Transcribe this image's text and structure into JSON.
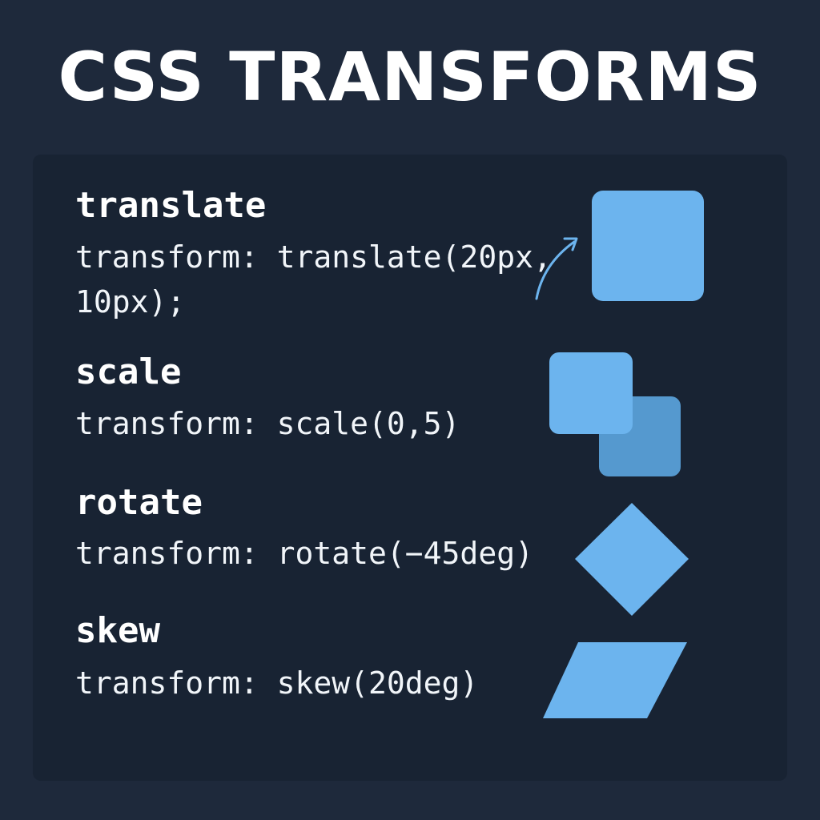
{
  "title": "CSS TRANSFORMS",
  "colors": {
    "background": "#1e293b",
    "panel": "#182333",
    "shape_primary": "#6cb4ee",
    "shape_secondary": "#5599cf",
    "text": "#ffffff"
  },
  "transforms": [
    {
      "name": "translate",
      "code_line1": "transform: translate(20px,",
      "code_line2": "10px);",
      "illustration": "arrow-pointing-to-translated-square"
    },
    {
      "name": "scale",
      "code_line1": "transform: scale(0,5)",
      "illustration": "overlapping-squares"
    },
    {
      "name": "rotate",
      "code_line1": "transform: rotate(−45deg)",
      "illustration": "diamond"
    },
    {
      "name": "skew",
      "code_line1": "transform: skew(20deg)",
      "illustration": "parallelogram"
    }
  ]
}
